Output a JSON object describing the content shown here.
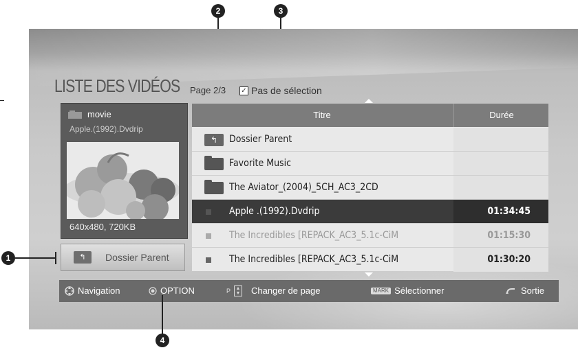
{
  "screen": {
    "title": "LISTE DES VIDÉOS",
    "page_info": "Page 2/3",
    "selection": "Pas de sélection",
    "checkbox_mark": "✓"
  },
  "preview": {
    "folder": "movie",
    "file": "Apple.(1992).Dvdrip",
    "details": "640x480, 720KB",
    "parent_button": "Dossier Parent"
  },
  "table": {
    "col_title": "Titre",
    "col_duration": "Durée",
    "rows": [
      {
        "name": "Dossier Parent",
        "duration": "",
        "kind": "parent"
      },
      {
        "name": "Favorite Music",
        "duration": "",
        "kind": "folder"
      },
      {
        "name": "The Aviator_(2004)_5CH_AC3_2CD",
        "duration": "",
        "kind": "folder"
      },
      {
        "name": "Apple .(1992).Dvdrip",
        "duration": "01:34:45",
        "kind": "file",
        "selected": true
      },
      {
        "name": "The Incredibles [REPACK_AC3_5.1c-CiM",
        "duration": "01:15:30",
        "kind": "file",
        "dimmed": true
      },
      {
        "name": "The Incredibles [REPACK_AC3_5.1c-CiM",
        "duration": "01:30:20",
        "kind": "file"
      }
    ]
  },
  "footer": {
    "navigation": "Navigation",
    "option": "OPTION",
    "page_key": "P",
    "change_page": "Changer de page",
    "mark_key": "MARK",
    "select": "Sélectionner",
    "exit": "Sortie"
  },
  "callouts": [
    "1",
    "2",
    "3",
    "4"
  ]
}
